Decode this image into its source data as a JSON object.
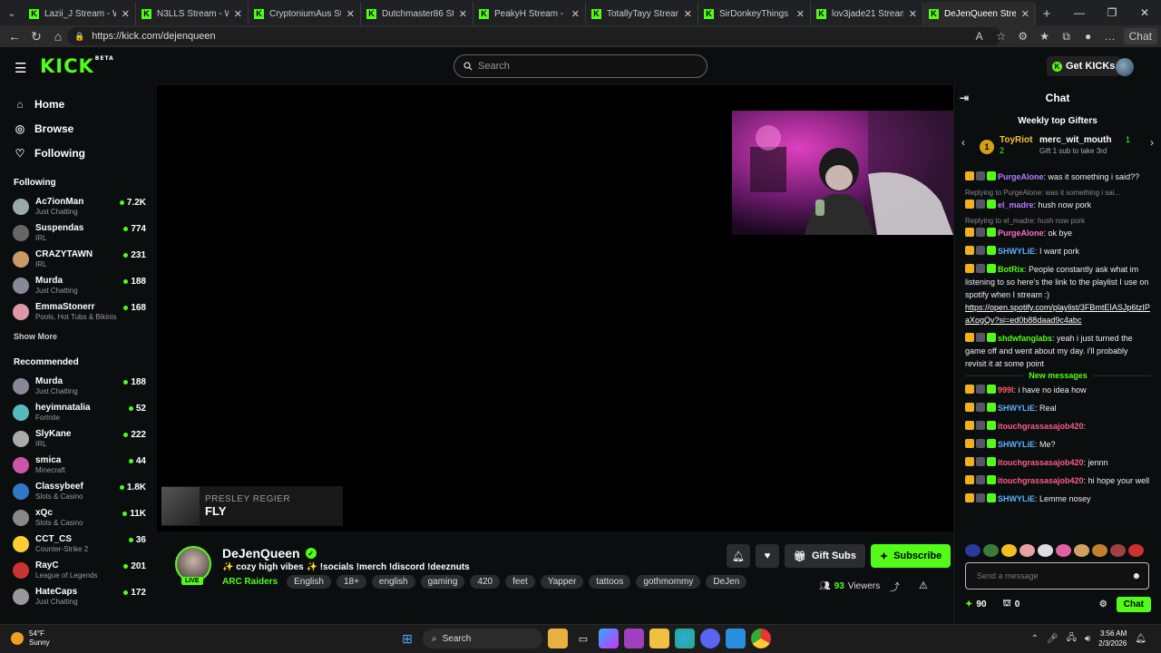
{
  "browser": {
    "tabs": [
      {
        "title": "Lazii_J Stream - Wa"
      },
      {
        "title": "N3LLS Stream - Wa"
      },
      {
        "title": "CryptoniumAus Stre"
      },
      {
        "title": "Dutchmaster86 Stre"
      },
      {
        "title": "PeakyH Stream - W"
      },
      {
        "title": "TotallyTayy Stream"
      },
      {
        "title": "SirDonkeyThings St"
      },
      {
        "title": "lov3jade21 Stream"
      },
      {
        "title": "DeJenQueen Strea"
      }
    ],
    "url": "https://kick.com/dejenqueen",
    "copilot_label": "Chat"
  },
  "header": {
    "logo": "KICK",
    "logo_badge": "BETA",
    "search_placeholder": "Search",
    "get_kicks": "Get KICKs"
  },
  "sidebar": {
    "nav": [
      {
        "label": "Home"
      },
      {
        "label": "Browse"
      },
      {
        "label": "Following"
      }
    ],
    "following_title": "Following",
    "following": [
      {
        "name": "Ac7ionMan",
        "category": "Just Chatting",
        "viewers": "7.2K"
      },
      {
        "name": "Suspendas",
        "category": "IRL",
        "viewers": "774"
      },
      {
        "name": "CRAZYTAWN",
        "category": "IRL",
        "viewers": "231"
      },
      {
        "name": "Murda",
        "category": "Just Chatting",
        "viewers": "188"
      },
      {
        "name": "EmmaStonerr",
        "category": "Pools, Hot Tubs & Bikinis",
        "viewers": "168"
      }
    ],
    "show_more": "Show More",
    "recommended_title": "Recommended",
    "recommended": [
      {
        "name": "Murda",
        "category": "Just Chatting",
        "viewers": "188"
      },
      {
        "name": "heyimnatalia",
        "category": "Fortnite",
        "viewers": "52"
      },
      {
        "name": "SlyKane",
        "category": "IRL",
        "viewers": "222"
      },
      {
        "name": "smica",
        "category": "Minecraft",
        "viewers": "44"
      },
      {
        "name": "Classybeef",
        "category": "Slots & Casino",
        "viewers": "1.8K"
      },
      {
        "name": "xQc",
        "category": "Slots & Casino",
        "viewers": "11K"
      },
      {
        "name": "CCT_CS",
        "category": "Counter-Strike 2",
        "viewers": "36"
      },
      {
        "name": "RayC",
        "category": "League of Legends",
        "viewers": "201"
      },
      {
        "name": "HateCaps",
        "category": "Just Chatting",
        "viewers": "172"
      }
    ]
  },
  "player": {
    "artist": "PRESLEY REGIER",
    "song": "FLY"
  },
  "stream": {
    "name": "DeJenQueen",
    "live": "LIVE",
    "title": "✨ cozy high vibes ✨ !socials !merch !discord !deeznuts",
    "category": "ARC Raiders",
    "tags": [
      "English",
      "18+",
      "english",
      "gaming",
      "420",
      "feet",
      "Yapper",
      "tattoos",
      "gothmommy",
      "DeJen"
    ],
    "gift_subs": "Gift Subs",
    "subscribe": "Subscribe",
    "viewers": "93",
    "viewers_label": "Viewers"
  },
  "chat": {
    "title": "Chat",
    "gifters_title": "Weekly top Gifters",
    "gifter1": {
      "rank": "1",
      "name": "ToyRiot",
      "count": "2"
    },
    "gifter2": {
      "name": "merc_wit_mouth",
      "count": "1"
    },
    "gift_cta": "Gift 1 sub to take 3rd",
    "messages": [
      {
        "user": "PurgeAlone",
        "text": "was it something i said??",
        "color": "#b87cff"
      },
      {
        "reply": "Replying to PurgeAlone: was it something i sai...",
        "user": "el_madre",
        "text": "hush now pork",
        "color": "#b87cff"
      },
      {
        "reply": "Replying to el_madre: hush now pork",
        "user": "PurgeAlone",
        "text": "ok bye",
        "color": "#ff6ec7"
      },
      {
        "user": "SHWYLiE",
        "text": "I want pork",
        "color": "#5fb0ff"
      },
      {
        "user": "BotRix",
        "text": "People constantly ask what im listening to so here's the link to the playlist I use on spotify when I stream :)",
        "link": "https://open.spotify.com/playlist/3FBmtEIASJp6tzIPaXogQv?si=ed0b88daad9c4abc",
        "color": "#53fc18"
      },
      {
        "user": "shdwfanglabs",
        "text": "yeah i just turned the game off and went about my day. i'll probably revisit it at some point",
        "color": "#53fc18"
      }
    ],
    "new_messages_label": "New messages",
    "new_messages": [
      {
        "user": "999l",
        "text": "i have no idea how",
        "color": "#ff5c5c"
      },
      {
        "user": "SHWYLiE",
        "text": "Real",
        "color": "#5fb0ff"
      },
      {
        "user": "itouchgrassasajob420",
        "text": "",
        "color": "#ff5c8a"
      },
      {
        "user": "SHWYLiE",
        "text": "Me?",
        "color": "#5fb0ff"
      },
      {
        "user": "itouchgrassasajob420",
        "text": "jennn",
        "color": "#ff5c8a"
      },
      {
        "user": "itouchgrassasajob420",
        "text": "hi hope your well",
        "color": "#ff5c8a"
      },
      {
        "user": "SHWYLiE",
        "text": "Lemme nosey",
        "color": "#5fb0ff"
      }
    ],
    "input_placeholder": "Send a message",
    "points": "90",
    "drops": "0",
    "send_label": "Chat"
  },
  "taskbar": {
    "temp": "54°F",
    "weather": "Sunny",
    "search": "Search",
    "time": "3:56 AM",
    "date": "2/3/2026"
  }
}
